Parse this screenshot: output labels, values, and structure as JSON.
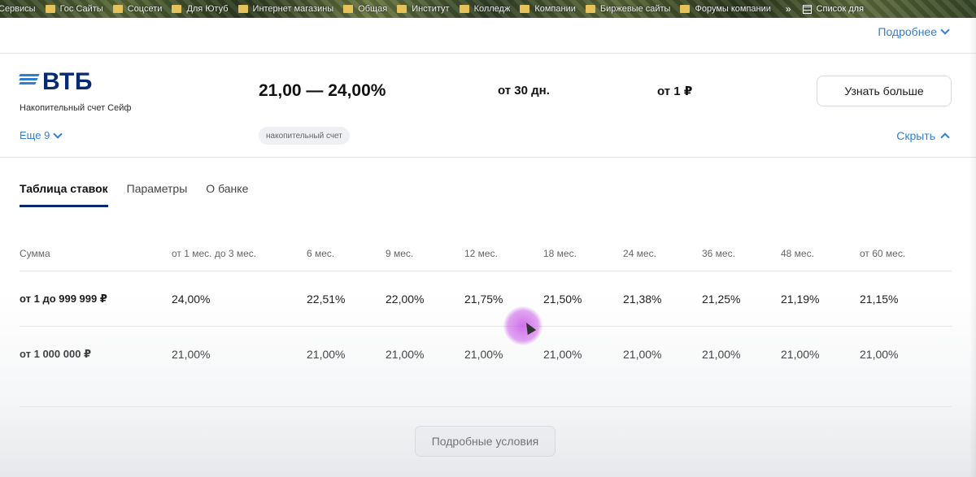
{
  "bookmarks": {
    "items": [
      {
        "label": "Сервисы",
        "folder": false
      },
      {
        "label": "Гос Сайты",
        "folder": true
      },
      {
        "label": "Соцсети",
        "folder": true
      },
      {
        "label": "Для Ютуб",
        "folder": true
      },
      {
        "label": "Интернет магазины",
        "folder": true
      },
      {
        "label": "Общая",
        "folder": true
      },
      {
        "label": "Институт",
        "folder": true
      },
      {
        "label": "Колледж",
        "folder": true
      },
      {
        "label": "Компании",
        "folder": true
      },
      {
        "label": "Биржевые сайты",
        "folder": true
      },
      {
        "label": "Форумы компании",
        "folder": true
      }
    ],
    "more": "»",
    "reading_list": "Список для"
  },
  "top": {
    "more_label": "Подробнее"
  },
  "product": {
    "brand": "ВТБ",
    "name": "Накопительный счет Сейф",
    "rate": "21,00 — 24,00%",
    "term": "от 30 дн.",
    "min_sum": "от 1 ₽",
    "learn_more": "Узнать больше",
    "more_count": "Еще 9",
    "tag": "накопительный счет",
    "hide": "Скрыть"
  },
  "tabs": [
    {
      "label": "Таблица ставок",
      "active": true
    },
    {
      "label": "Параметры",
      "active": false
    },
    {
      "label": "О банке",
      "active": false
    }
  ],
  "rates_table": {
    "headers": [
      "Сумма",
      "от 1 мес. до 3 мес.",
      "6 мес.",
      "9 мес.",
      "12 мес.",
      "18 мес.",
      "24 мес.",
      "36 мес.",
      "48 мес.",
      "от 60 мес."
    ],
    "rows": [
      [
        "от 1 до 999 999 ₽",
        "24,00%",
        "22,51%",
        "22,00%",
        "21,75%",
        "21,50%",
        "21,38%",
        "21,25%",
        "21,19%",
        "21,15%"
      ],
      [
        "от 1 000 000 ₽",
        "21,00%",
        "21,00%",
        "21,00%",
        "21,00%",
        "21,00%",
        "21,00%",
        "21,00%",
        "21,00%",
        "21,00%"
      ]
    ]
  },
  "details_button": "Подробные условия",
  "colors": {
    "accent": "#2f7fd1",
    "brand": "#0a2973",
    "cursor_highlight": "#c85ae6"
  }
}
